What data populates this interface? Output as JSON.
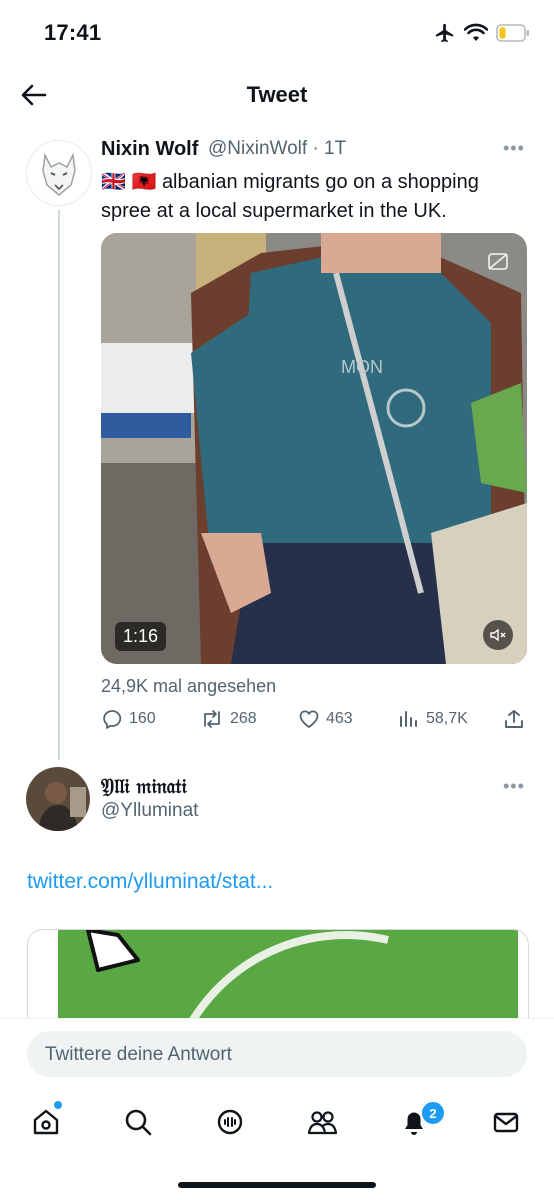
{
  "status_bar": {
    "time": "17:41",
    "icons": [
      "airplane-icon",
      "wifi-icon",
      "battery-icon"
    ]
  },
  "nav": {
    "title": "Tweet"
  },
  "tweet": {
    "author_name": "Nixin Wolf",
    "author_handle": "@NixinWolf · 1T",
    "flags": "🇬🇧 🇦🇱",
    "text": "albanian migrants go on a shopping spree at a local supermarket in the UK.",
    "video_duration": "1:16",
    "views": "24,9K mal angesehen",
    "replies": "160",
    "retweets": "268",
    "likes": "463",
    "impressions": "58,7K"
  },
  "reply": {
    "author_name": "𝔜𝔩𝔩𝔦 𝔪𝔦𝔫𝔞𝔱𝔦",
    "author_handle": "@Ylluminat",
    "link": "twitter.com/ylluminat/stat..."
  },
  "composer": {
    "placeholder": "Twittere deine Antwort"
  },
  "tabbar": {
    "notifications_badge": "2"
  },
  "colors": {
    "accent": "#1d9bf0",
    "text": "#0f1419",
    "muted": "#536471"
  }
}
